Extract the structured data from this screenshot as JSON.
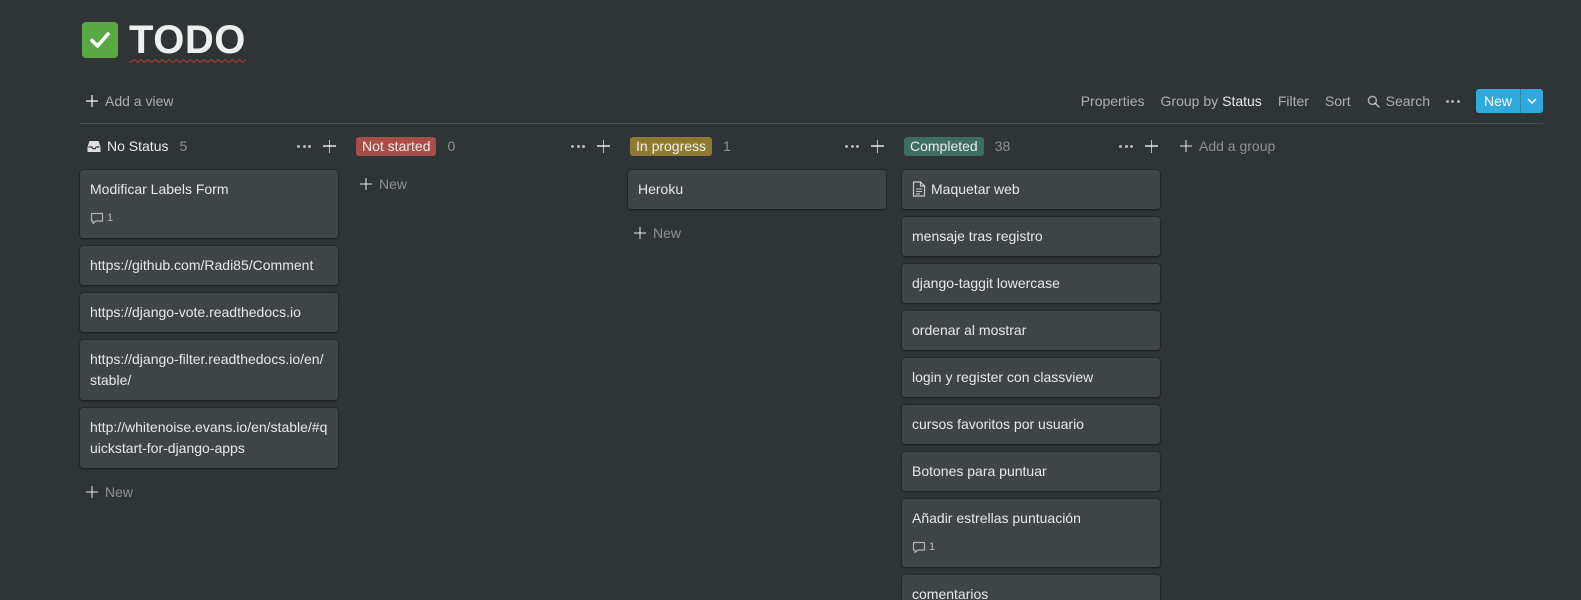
{
  "page": {
    "title": "TODO",
    "title_icon": "check-mark-icon"
  },
  "toolbar": {
    "add_view": "Add a view",
    "properties": "Properties",
    "group_by": "Group by",
    "group_by_value": "Status",
    "filter": "Filter",
    "sort": "Sort",
    "search": "Search",
    "new": "New"
  },
  "board": {
    "add_group": "Add a group",
    "new_label": "New",
    "groups": [
      {
        "name": "No Status",
        "count": "5",
        "color": "",
        "cards": [
          {
            "title": "Modificar Labels Form",
            "comments": "1"
          },
          {
            "title": "https://github.com/Radi85/Comment"
          },
          {
            "title": "https://django-vote.readthedocs.io"
          },
          {
            "title": "https://django-filter.readthedocs.io/en/stable/"
          },
          {
            "title": "http://whitenoise.evans.io/en/stable/#quickstart-for-django-apps"
          }
        ]
      },
      {
        "name": "Not started",
        "count": "0",
        "color": "#a84e48",
        "cards": []
      },
      {
        "name": "In progress",
        "count": "1",
        "color": "#8f7a33",
        "cards": [
          {
            "title": "Heroku"
          }
        ]
      },
      {
        "name": "Completed",
        "count": "38",
        "color": "#3e6e61",
        "cards": [
          {
            "title": "Maquetar web",
            "icon": "document-icon"
          },
          {
            "title": "mensaje tras registro"
          },
          {
            "title": "django-taggit lowercase"
          },
          {
            "title": "ordenar al mostrar"
          },
          {
            "title": "login y register con classview"
          },
          {
            "title": "cursos favoritos por usuario"
          },
          {
            "title": "Botones para puntuar"
          },
          {
            "title": "Añadir estrellas puntuación",
            "comments": "1"
          },
          {
            "title": "comentarios"
          }
        ]
      }
    ]
  },
  "colors": {
    "background": "#2f3437",
    "card": "#3f4447",
    "accent": "#2eaadc",
    "title_icon_bg": "#5aa845"
  }
}
